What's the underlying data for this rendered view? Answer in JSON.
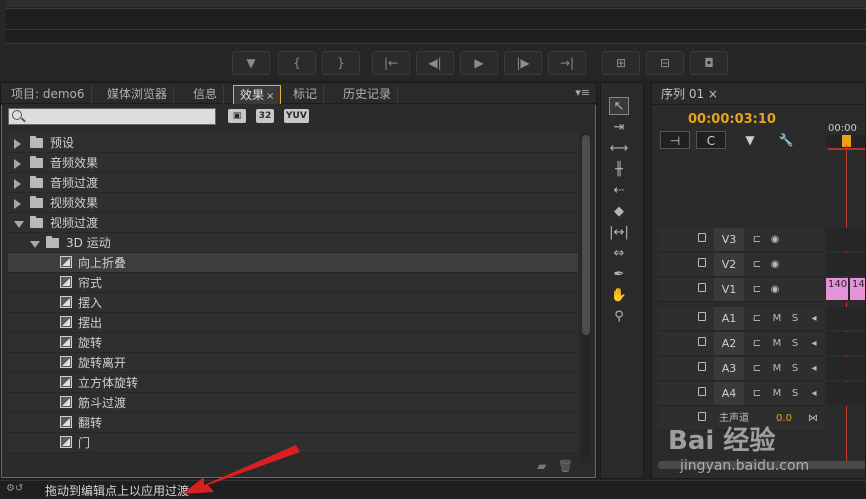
{
  "effects_panel": {
    "tabs": [
      {
        "label": "项目: demo6"
      },
      {
        "label": "媒体浏览器"
      },
      {
        "label": "信息"
      },
      {
        "label": "效果",
        "active": true
      },
      {
        "label": "标记"
      },
      {
        "label": "历史记录"
      }
    ],
    "close_glyph": "×",
    "menu_glyph": "▾≡",
    "search": {
      "placeholder": "",
      "value": ""
    },
    "format_buttons": [
      "",
      "32",
      "YUV"
    ],
    "tree": [
      {
        "label": "预设",
        "level": 0,
        "type": "folder",
        "expanded": false
      },
      {
        "label": "音频效果",
        "level": 0,
        "type": "folder",
        "expanded": false
      },
      {
        "label": "音频过渡",
        "level": 0,
        "type": "folder",
        "expanded": false
      },
      {
        "label": "视频效果",
        "level": 0,
        "type": "folder",
        "expanded": false
      },
      {
        "label": "视频过渡",
        "level": 0,
        "type": "folder",
        "expanded": true
      },
      {
        "label": "3D 运动",
        "level": 1,
        "type": "folder",
        "expanded": true
      },
      {
        "label": "向上折叠",
        "level": 2,
        "type": "effect",
        "selected": true
      },
      {
        "label": "帘式",
        "level": 2,
        "type": "effect"
      },
      {
        "label": "摆入",
        "level": 2,
        "type": "effect"
      },
      {
        "label": "摆出",
        "level": 2,
        "type": "effect"
      },
      {
        "label": "旋转",
        "level": 2,
        "type": "effect"
      },
      {
        "label": "旋转离开",
        "level": 2,
        "type": "effect"
      },
      {
        "label": "立方体旋转",
        "level": 2,
        "type": "effect"
      },
      {
        "label": "筋斗过渡",
        "level": 2,
        "type": "effect"
      },
      {
        "label": "翻转",
        "level": 2,
        "type": "effect"
      },
      {
        "label": "门",
        "level": 2,
        "type": "effect"
      }
    ]
  },
  "timeline": {
    "tab_label": "序列 01",
    "close_glyph": "×",
    "timecode": "00:00:03:10",
    "ruler_time": "00:00",
    "video_tracks": [
      "V3",
      "V2",
      "V1"
    ],
    "audio_tracks": [
      "A1",
      "A2",
      "A3",
      "A4"
    ],
    "mute_label": "M",
    "solo_label": "S",
    "master_label": "主声道",
    "master_value": "0.0",
    "clips": [
      "140",
      "14"
    ]
  },
  "status_bar": {
    "text": "拖动到编辑点上以应用过渡"
  },
  "watermark": {
    "line1": "Bai 经验",
    "line2": "jingyan.baidu.com"
  },
  "colors": {
    "accent": "#e8a317",
    "active_tab_border": "#e8b02c",
    "clip": "#e294d6",
    "playhead_line": "#c0392b",
    "arrow": "#d92020"
  }
}
